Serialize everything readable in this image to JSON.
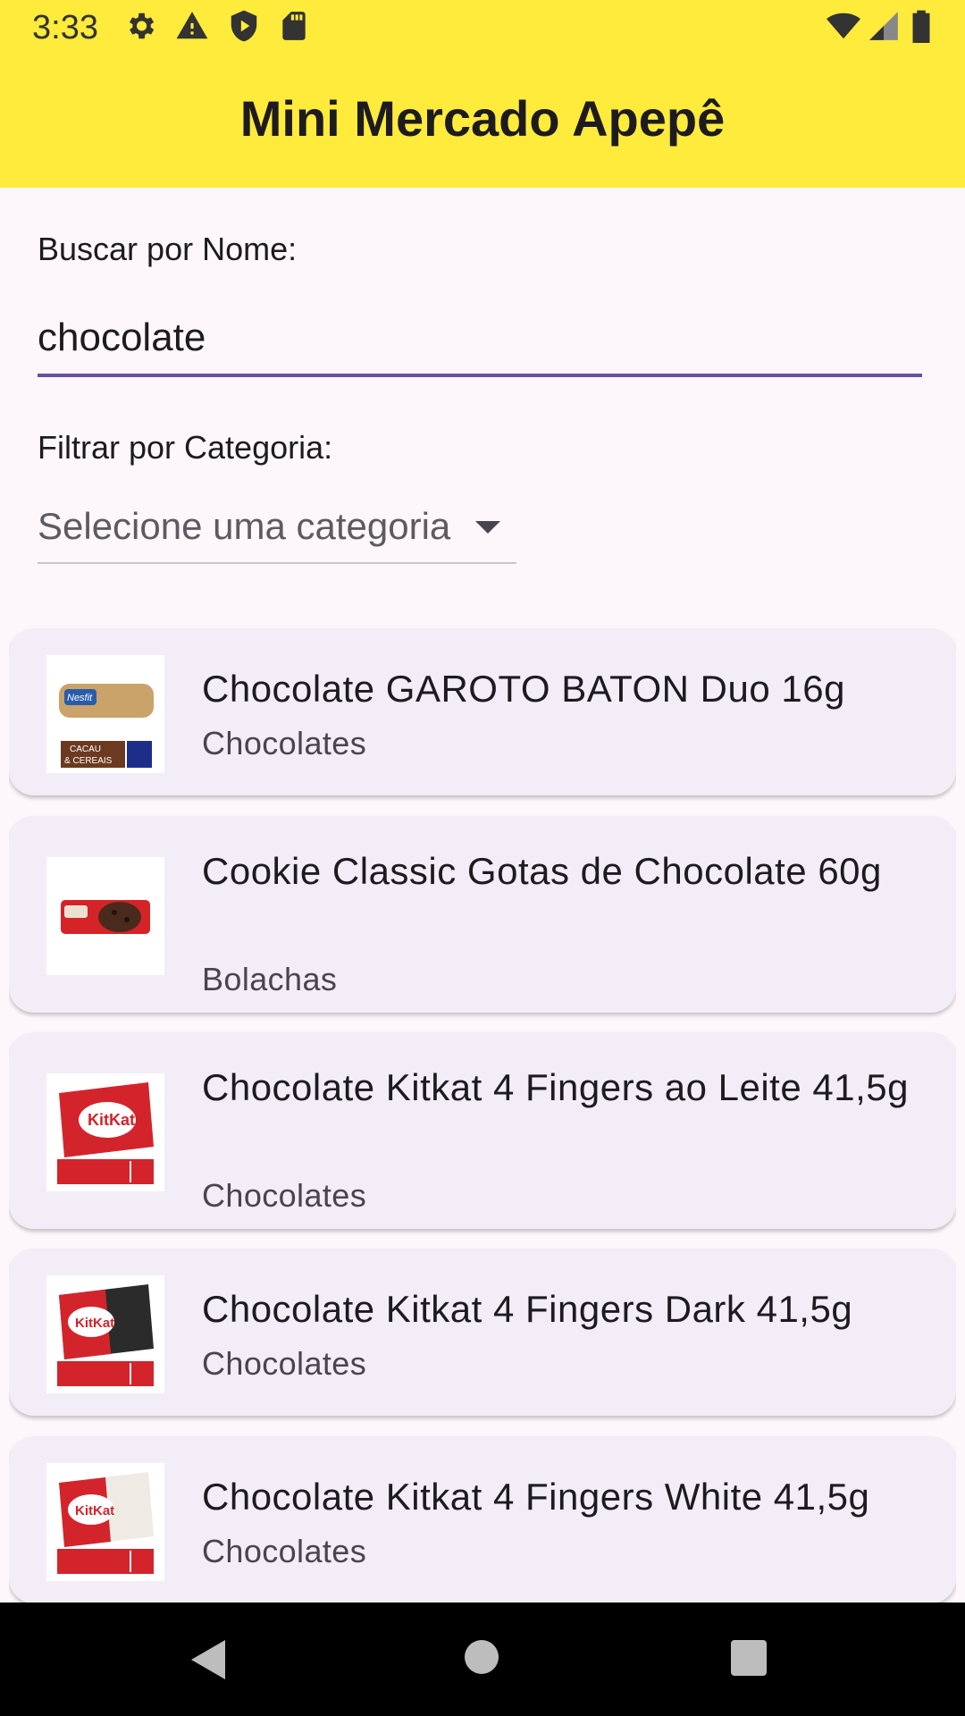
{
  "status_bar": {
    "time": "3:33",
    "icons": [
      "settings-icon",
      "warning-icon",
      "shield-icon",
      "sd-card-icon",
      "wifi-icon",
      "signal-icon",
      "battery-icon"
    ]
  },
  "app_bar": {
    "title": "Mini Mercado Apepê",
    "background": "#FFEB3B"
  },
  "search": {
    "label": "Buscar por Nome:",
    "value": "chocolate",
    "underline_color": "#6750A4"
  },
  "filter": {
    "label": "Filtrar por Categoria:",
    "selected": "Selecione uma categoria"
  },
  "products": [
    {
      "name": "Chocolate GAROTO BATON Duo 16g",
      "category": "Chocolates",
      "image": "nesfit-cookie-image"
    },
    {
      "name": "Cookie Classic Gotas de Chocolate 60g",
      "category": "Bolachas",
      "image": "nestle-cookie-image"
    },
    {
      "name": "Chocolate Kitkat 4 Fingers ao Leite 41,5g",
      "category": "Chocolates",
      "image": "kitkat-milk-image"
    },
    {
      "name": "Chocolate Kitkat 4 Fingers Dark 41,5g",
      "category": "Chocolates",
      "image": "kitkat-dark-image"
    },
    {
      "name": "Chocolate Kitkat 4 Fingers White 41,5g",
      "category": "Chocolates",
      "image": "kitkat-white-image"
    }
  ],
  "navigation": [
    "back-icon",
    "home-icon",
    "recents-icon"
  ]
}
